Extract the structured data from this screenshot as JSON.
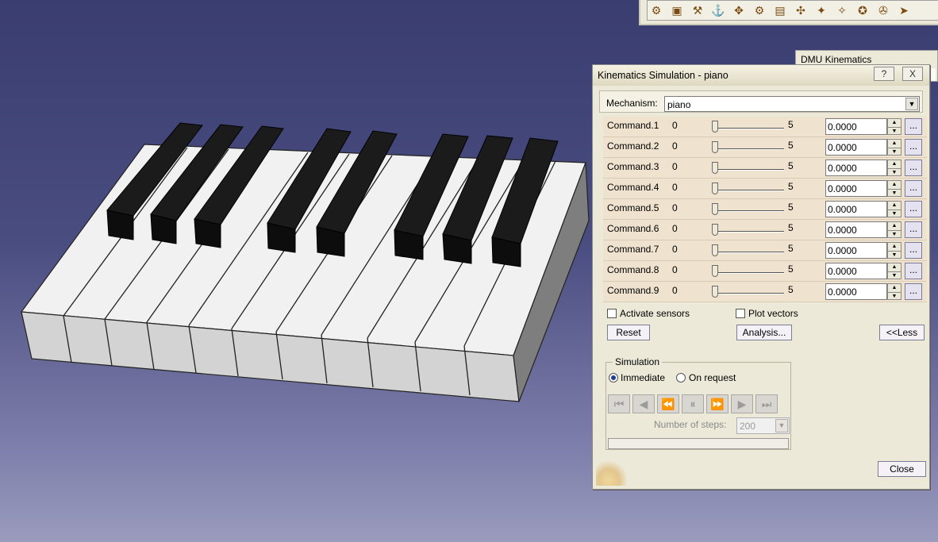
{
  "toolbar": {
    "icons": [
      "assemble-icon",
      "part-icon",
      "fix-icon",
      "snap-icon",
      "move-icon",
      "joint-icon",
      "box-icon",
      "mechanism-icon",
      "simulation-icon",
      "sensor-icon",
      "sweep-icon",
      "clash-icon",
      "arrow-icon"
    ]
  },
  "dmu_panel": {
    "title": "DMU Kinematics"
  },
  "dialog": {
    "title": "Kinematics Simulation - piano",
    "help_label": "?",
    "close_x_label": "X",
    "mechanism_label": "Mechanism:",
    "mechanism_value": "piano",
    "commands": [
      {
        "name": "Command.1",
        "min": "0",
        "max": "5",
        "value": "0.0000"
      },
      {
        "name": "Command.2",
        "min": "0",
        "max": "5",
        "value": "0.0000"
      },
      {
        "name": "Command.3",
        "min": "0",
        "max": "5",
        "value": "0.0000"
      },
      {
        "name": "Command.4",
        "min": "0",
        "max": "5",
        "value": "0.0000"
      },
      {
        "name": "Command.5",
        "min": "0",
        "max": "5",
        "value": "0.0000"
      },
      {
        "name": "Command.6",
        "min": "0",
        "max": "5",
        "value": "0.0000"
      },
      {
        "name": "Command.7",
        "min": "0",
        "max": "5",
        "value": "0.0000"
      },
      {
        "name": "Command.8",
        "min": "0",
        "max": "5",
        "value": "0.0000"
      },
      {
        "name": "Command.9",
        "min": "0",
        "max": "5",
        "value": "0.0000"
      }
    ],
    "dots_label": "...",
    "activate_sensors_label": "Activate sensors",
    "plot_vectors_label": "Plot vectors",
    "reset_label": "Reset",
    "analysis_label": "Analysis...",
    "less_label": "<<Less",
    "simulation_legend": "Simulation",
    "immediate_label": "Immediate",
    "on_request_label": "On request",
    "steps_label": "Number of steps:",
    "steps_value": "200",
    "close_label": "Close"
  }
}
